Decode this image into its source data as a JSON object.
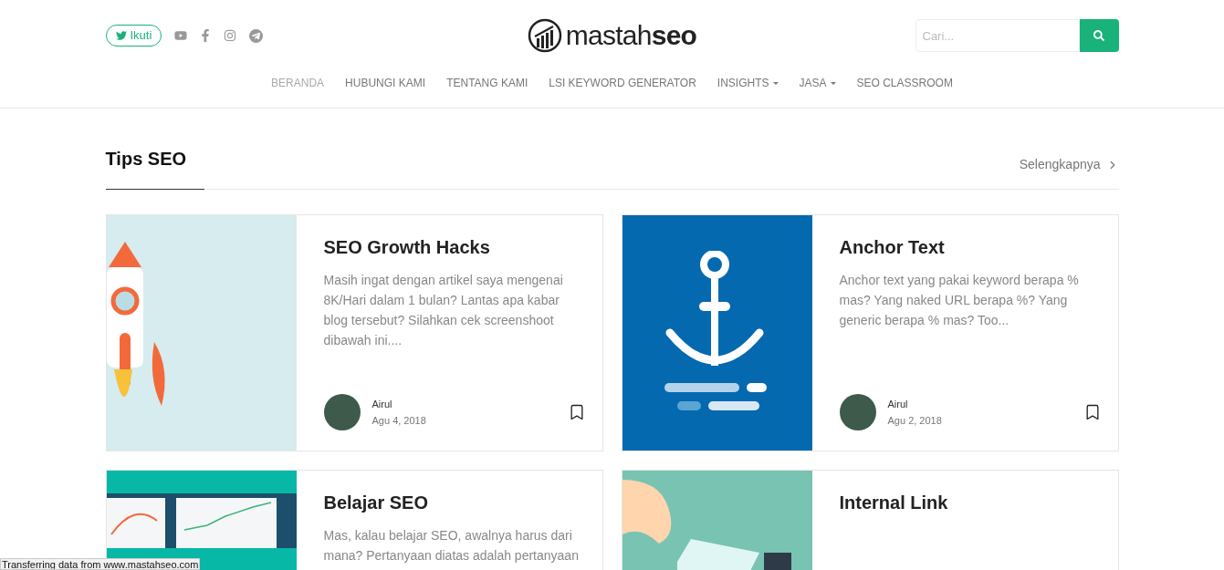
{
  "header": {
    "follow_button": "Ikuti",
    "logo": "mastah**seo**",
    "search": {
      "placeholder": "Cari..."
    }
  },
  "nav": [
    {
      "label": "BERANDA",
      "selected": true,
      "has_dropdown": false
    },
    {
      "label": "HUBUNGI KAMI",
      "selected": false,
      "has_dropdown": false
    },
    {
      "label": "TENTANG KAMI",
      "selected": false,
      "has_dropdown": false
    },
    {
      "label": "LSI KEYWORD GENERATOR",
      "selected": false,
      "has_dropdown": false
    },
    {
      "label": "INSIGHTS",
      "selected": false,
      "has_dropdown": true
    },
    {
      "label": "JASA",
      "selected": false,
      "has_dropdown": true
    },
    {
      "label": "SEO CLASSROOM",
      "selected": false,
      "has_dropdown": false
    }
  ],
  "section": {
    "title": "Tips SEO",
    "more_link": "Selengkapnya"
  },
  "posts": [
    {
      "kind": "rocket",
      "title": "SEO Growth Hacks",
      "excerpt": "Masih ingat dengan artikel saya mengenai 8K/Hari dalam 1 bulan? Lantas apa kabar blog tersebut? Silahkan cek screenshoot dibawah ini....",
      "author": "Airul",
      "date": "Agu 4, 2018"
    },
    {
      "kind": "anchor",
      "title": "Anchor Text",
      "excerpt": "Anchor text yang pakai keyword berapa % mas? Yang naked URL berapa %? Yang generic berapa % mas? Too...",
      "author": "Airul",
      "date": "Agu 2, 2018"
    },
    {
      "kind": "charts",
      "title": "Belajar SEO",
      "excerpt": "Mas, kalau belajar SEO, awalnya harus dari mana? Pertanyaan diatas adalah pertanyaan"
    },
    {
      "kind": "puzzle",
      "title": "Internal Link"
    }
  ],
  "status_bar": "Transferring data from www.mastahseo.com"
}
